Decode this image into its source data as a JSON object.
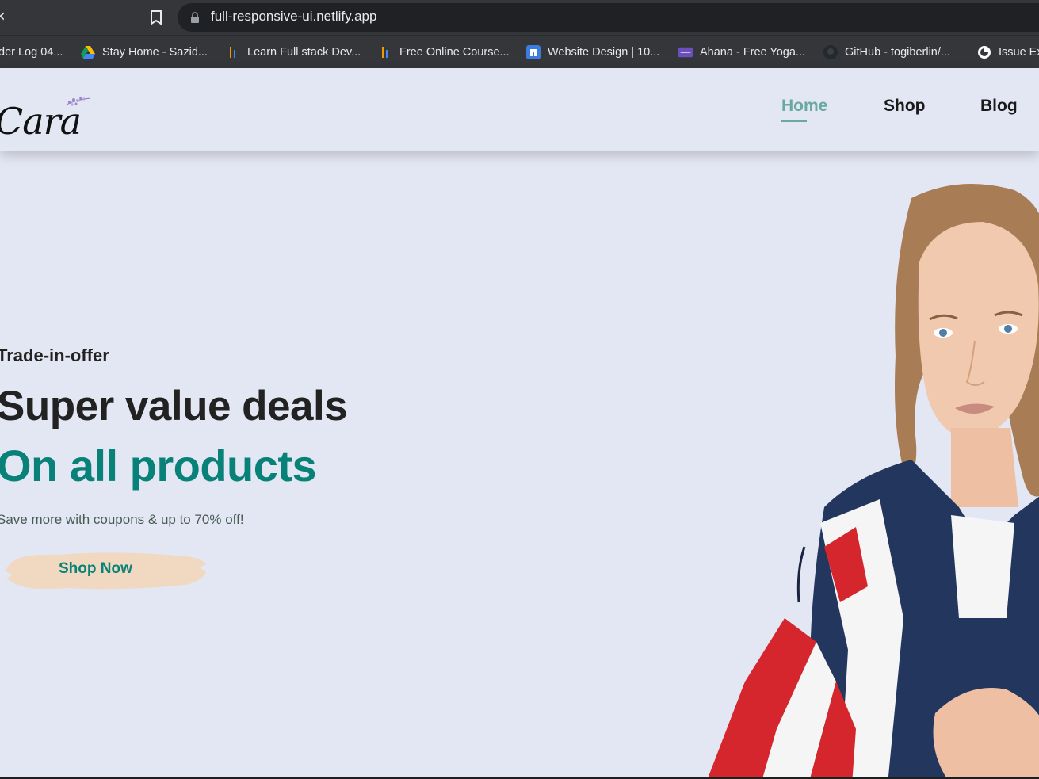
{
  "browser": {
    "url": "full-responsive-ui.netlify.app",
    "bookmarks": [
      {
        "label": "der Log 04...",
        "icon": "none"
      },
      {
        "label": "Stay Home - Sazid...",
        "icon": "google-drive-icon"
      },
      {
        "label": "Learn Full stack Dev...",
        "icon": "chart-bars-icon"
      },
      {
        "label": "Free Online Course...",
        "icon": "chart-bars-icon"
      },
      {
        "label": "Website Design | 10...",
        "icon": "n-logo-icon"
      },
      {
        "label": "Ahana - Free Yoga...",
        "icon": "colorlib-icon"
      },
      {
        "label": "GitHub - togiberlin/...",
        "icon": "github-icon"
      },
      {
        "label": "Issue Ex",
        "icon": "issue-icon"
      }
    ]
  },
  "header": {
    "logo": "Cara",
    "nav": [
      {
        "label": "Home",
        "active": true
      },
      {
        "label": "Shop",
        "active": false
      },
      {
        "label": "Blog",
        "active": false
      }
    ]
  },
  "hero": {
    "kicker": "Trade-in-offer",
    "headline": "Super value deals",
    "highlight": "On all products",
    "description": "Save more with coupons & up to 70% off!",
    "button_label": "Shop Now"
  },
  "colors": {
    "background": "#e3e6f3",
    "accent": "#088178",
    "nav_active": "#6aa9a0",
    "button_bg": "#f0d9c0",
    "chrome": "#35363a"
  }
}
